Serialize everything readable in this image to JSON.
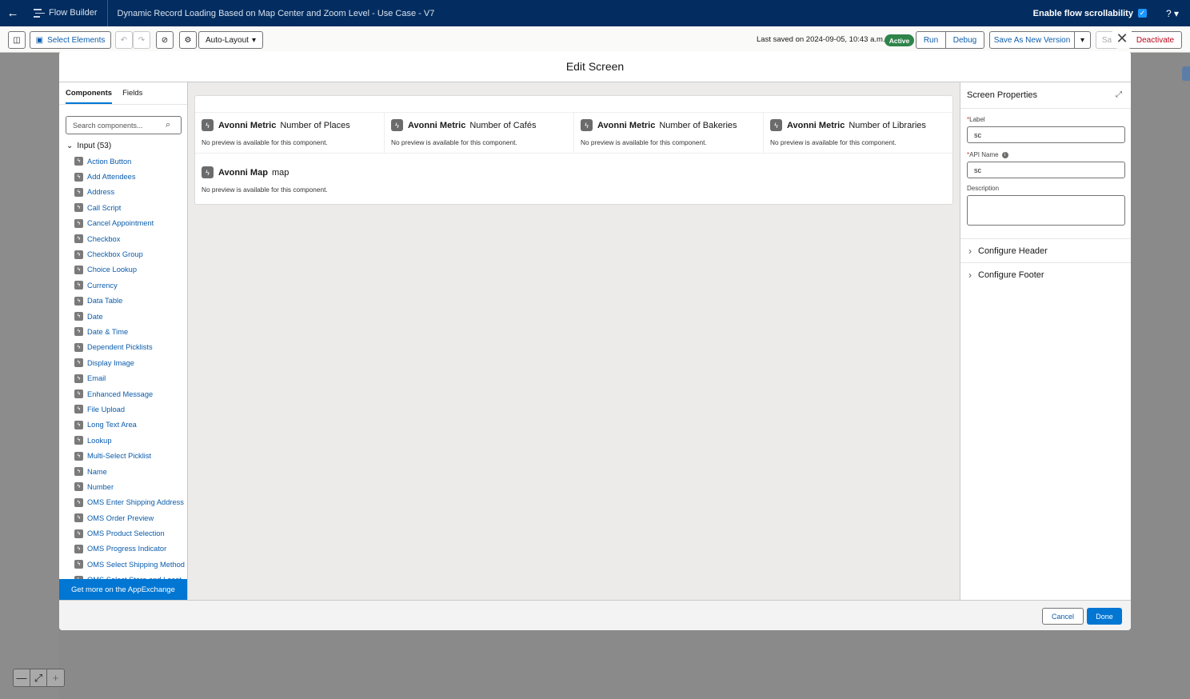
{
  "topbar": {
    "app_name": "Flow Builder",
    "flow_title": "Dynamic Record Loading Based on Map Center and Zoom Level - Use Case - V7",
    "scroll_label": "Enable flow scrollability",
    "help": "? ▾"
  },
  "toolbar": {
    "select_elements": "Select Elements",
    "layout": "Auto-Layout",
    "last_saved": "Last saved on 2024-09-05, 10:43 a.m.",
    "status": "Active",
    "run": "Run",
    "debug": "Debug",
    "save_new": "Save As New Version",
    "save_partial": "Sa",
    "deactivate": "Deactivate"
  },
  "modal": {
    "title": "Edit Screen"
  },
  "palette": {
    "tabs": [
      "Components",
      "Fields"
    ],
    "search_placeholder": "Search components...",
    "section": "Input (53)",
    "items": [
      "Action Button",
      "Add Attendees",
      "Address",
      "Call Script",
      "Cancel Appointment",
      "Checkbox",
      "Checkbox Group",
      "Choice Lookup",
      "Currency",
      "Data Table",
      "Date",
      "Date & Time",
      "Dependent Picklists",
      "Display Image",
      "Email",
      "Enhanced Message",
      "File Upload",
      "Long Text Area",
      "Lookup",
      "Multi-Select Picklist",
      "Name",
      "Number",
      "OMS Enter Shipping Address",
      "OMS Order Preview",
      "OMS Product Selection",
      "OMS Progress Indicator",
      "OMS Select Shipping Method",
      "OMS Select Store and Locat"
    ],
    "appexchange": "Get more on the AppExchange"
  },
  "canvas": {
    "metrics": [
      {
        "type": "Avonni Metric",
        "name": "Number of Places",
        "preview": "No preview is available for this component."
      },
      {
        "type": "Avonni Metric",
        "name": "Number of Cafés",
        "preview": "No preview is available for this component."
      },
      {
        "type": "Avonni Metric",
        "name": "Number of Bakeries",
        "preview": "No preview is available for this component."
      },
      {
        "type": "Avonni Metric",
        "name": "Number of Libraries",
        "preview": "No preview is available for this component."
      }
    ],
    "map": {
      "type": "Avonni Map",
      "name": "map",
      "preview": "No preview is available for this component."
    }
  },
  "properties": {
    "title": "Screen Properties",
    "label_label": "Label",
    "label_value": "sc",
    "api_label": "API Name",
    "api_value": "sc",
    "description_label": "Description",
    "configure_header": "Configure Header",
    "configure_footer": "Configure Footer"
  },
  "footer": {
    "cancel": "Cancel",
    "done": "Done"
  },
  "colors": {
    "brand": "#0176d3",
    "header": "#032d60",
    "active_badge": "#2e844a",
    "deactivate": "#ba0517"
  }
}
